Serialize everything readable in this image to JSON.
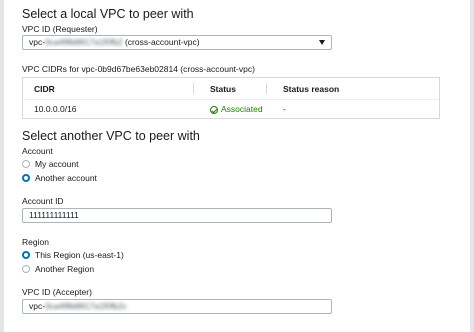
{
  "local": {
    "heading": "Select a local VPC to peer with",
    "vpc_label": "VPC ID (Requester)",
    "vpc_prefix": "vpc-",
    "vpc_redacted": "0ca4f8b8817a1f0fb2",
    "vpc_suffix": "(cross-account-vpc)",
    "cidr_caption": "VPC CIDRs for vpc-0b9d67be63eb02814 (cross-account-vpc)",
    "cidr_table": {
      "columns": [
        "CIDR",
        "Status",
        "Status reason"
      ],
      "rows": [
        {
          "cidr": "10.0.0.0/16",
          "status": "Associated",
          "reason": "-"
        }
      ]
    }
  },
  "other": {
    "heading": "Select another VPC to peer with",
    "account_label": "Account",
    "account_options": [
      {
        "label": "My account",
        "checked": false
      },
      {
        "label": "Another account",
        "checked": true
      }
    ],
    "account_id_label": "Account ID",
    "account_id_value": "111111111111",
    "region_label": "Region",
    "region_options": [
      {
        "label": "This Region (us-east-1)",
        "checked": true
      },
      {
        "label": "Another Region",
        "checked": false
      }
    ],
    "accepter_label": "VPC ID (Accepter)",
    "accepter_prefix": "vpc-",
    "accepter_redacted": "0ca4f8b8817a1f0fb2c"
  },
  "colors": {
    "accent": "#0073bb",
    "success": "#1d8102",
    "border": "#aab7b8"
  },
  "icons": {
    "dropdown": "caret-down-icon",
    "status": "check-circle-icon"
  }
}
